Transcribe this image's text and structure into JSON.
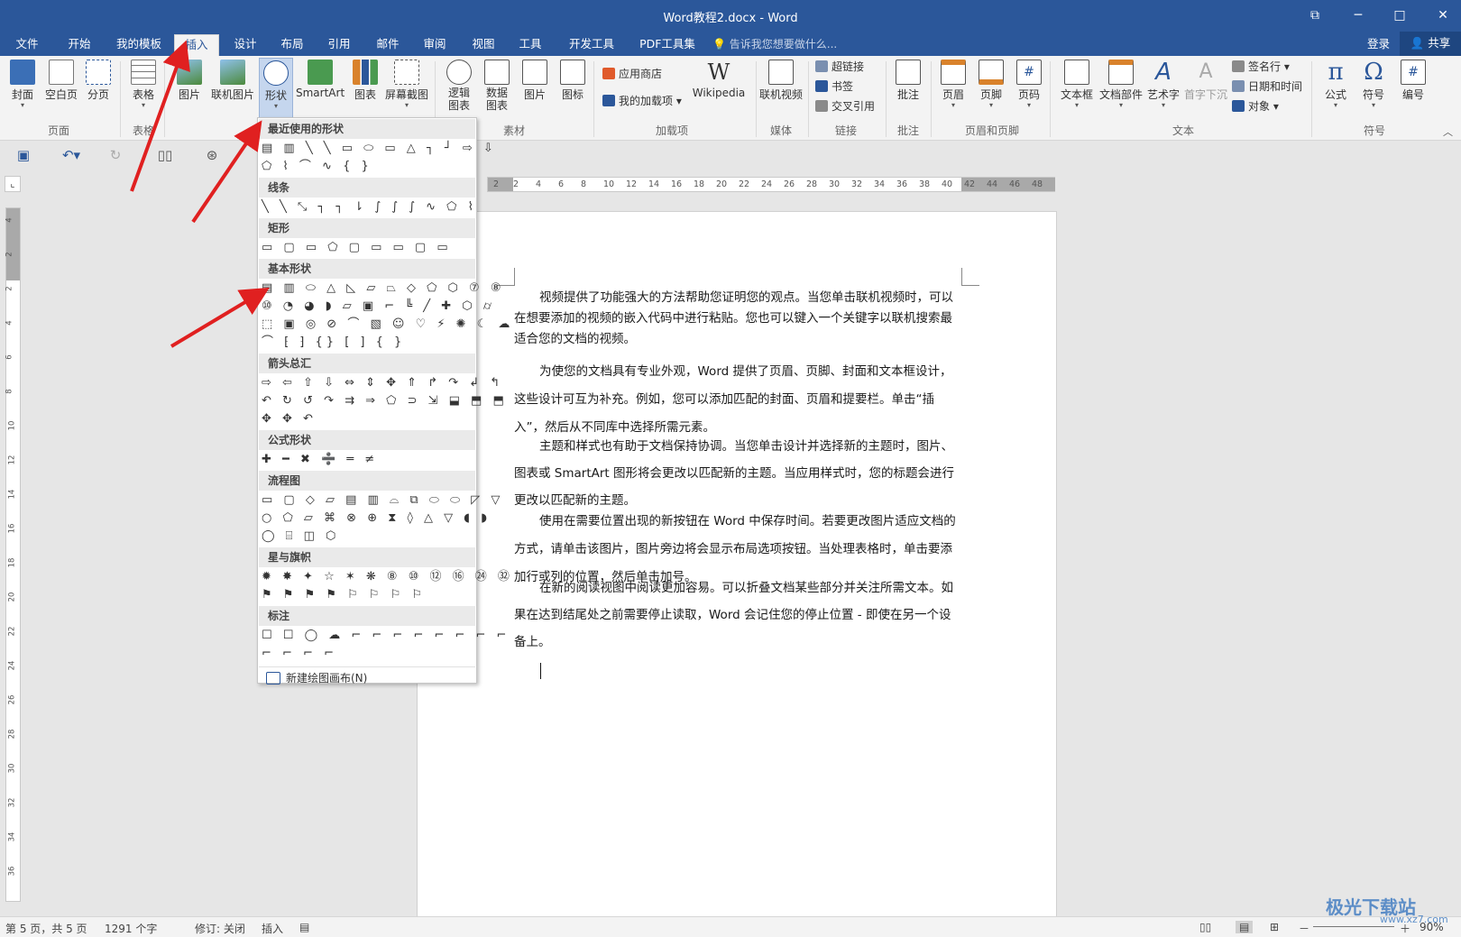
{
  "window": {
    "title": "Word教程2.docx - Word",
    "restore_label": "⧉",
    "minimize_label": "─",
    "maximize_label": "□",
    "close_label": "✕"
  },
  "tabs": [
    "文件",
    "开始",
    "我的模板",
    "插入",
    "设计",
    "布局",
    "引用",
    "邮件",
    "审阅",
    "视图",
    "工具",
    "开发工具",
    "PDF工具集"
  ],
  "active_tab": "插入",
  "tell_me": "告诉我您想要做什么...",
  "login": "登录",
  "share": "共享",
  "ribbon": {
    "pages": {
      "cover": "封面",
      "blank": "空白页",
      "break": "分页",
      "group": "页面"
    },
    "tables": {
      "table": "表格",
      "group": "表格"
    },
    "illus": {
      "picture": "图片",
      "online_picture": "联机图片",
      "shapes": "形状",
      "smartart": "SmartArt",
      "chart": "图表",
      "screenshot": "屏幕截图"
    },
    "material": {
      "logic": "逻辑",
      "logic2": "图表",
      "data": "数据",
      "data2": "图表",
      "picture": "图片",
      "icon": "图标",
      "group": "素材"
    },
    "addins": {
      "store": "应用商店",
      "my_addins": "我的加载项",
      "wikipedia": "Wikipedia",
      "group": "加载项"
    },
    "media": {
      "online_video": "联机视频",
      "group": "媒体"
    },
    "links": {
      "hyperlink": "超链接",
      "bookmark": "书签",
      "crossref": "交叉引用",
      "group": "链接"
    },
    "comments": {
      "comment": "批注",
      "group": "批注"
    },
    "header_footer": {
      "header": "页眉",
      "footer": "页脚",
      "page_number": "页码",
      "group": "页眉和页脚"
    },
    "text": {
      "textbox": "文本框",
      "quickparts": "文档部件",
      "wordart": "艺术字",
      "dropcap": "首字下沉",
      "signature": "签名行",
      "datetime": "日期和时间",
      "object": "对象",
      "group": "文本"
    },
    "symbols": {
      "equation": "公式",
      "symbol": "符号",
      "number": "编号",
      "group": "符号"
    }
  },
  "shapes_gallery": {
    "sections": [
      {
        "title": "最近使用的形状",
        "rows": [
          "▤ ▥ ╲ ╲ ▭ ⬭ ▭ △ ┐ ┘ ⇨ ⇩",
          "⬠ ⌇ ⌒ ∿ { }"
        ]
      },
      {
        "title": "线条",
        "rows": [
          "╲ ╲ ⤡ ┐ ┐ ⇂ ∫ ∫ ∫ ∿ ⬠ ⌇"
        ]
      },
      {
        "title": "矩形",
        "rows": [
          "▭ ▢ ▭ ⬠ ▢ ▭ ▭ ▢ ▭"
        ]
      },
      {
        "title": "基本形状",
        "rows": [
          "▤ ▥ ⬭ △ ◺ ▱ ⏢ ◇ ⬠ ⬡ ⑦ ⑧",
          "⑩ ◔ ◕ ◗ ▱ ▣ ⌐ ╚ ╱ ✚ ⬡ ⌭",
          "⬚ ▣ ◎ ⊘ ⌒ ▧ ☺ ♡ ⚡ ✺ ☾ ☁",
          "⌒ ⁅ ⁆ {} [ ] { }"
        ]
      },
      {
        "title": "箭头总汇",
        "rows": [
          "⇨ ⇦ ⇧ ⇩ ⇔ ⇕ ✥ ⇑ ↱ ↷ ↲ ↰",
          "↶ ↻ ↺ ↷ ⇉ ⇒ ⬠ ⊃ ⇲ ⬓ ⬒ ⬒",
          "✥ ✥ ↶"
        ]
      },
      {
        "title": "公式形状",
        "rows": [
          "✚ ━ ✖ ➗ ═ ≠"
        ]
      },
      {
        "title": "流程图",
        "rows": [
          "▭ ▢ ◇ ▱ ▤ ▥ ⌓ ⧉ ⬭ ⬭ ◸ ▽",
          "○ ⬠ ▱ ⌘ ⊗ ⊕ ⧗ ◊ △ ▽ ◖ ◗",
          "◯ ⌸ ◫ ⬡"
        ]
      },
      {
        "title": "星与旗帜",
        "rows": [
          "✹ ✸ ✦ ☆ ✶ ❋ ⑧ ⑩ ⑫ ⑯ ㉔ ㉜",
          "⚑ ⚑ ⚑ ⚑ ⚐ ⚐ ⚐ ⚐"
        ]
      },
      {
        "title": "标注",
        "rows": [
          "☐ ☐ ◯ ☁ ⌐ ⌐ ⌐ ⌐ ⌐ ⌐ ⌐ ⌐",
          "⌐ ⌐ ⌐ ⌐"
        ]
      }
    ],
    "new_canvas": "新建绘图画布(N)"
  },
  "ruler_h": [
    "2",
    "2",
    "4",
    "6",
    "8",
    "10",
    "12",
    "14",
    "16",
    "18",
    "20",
    "22",
    "24",
    "26",
    "28",
    "30",
    "32",
    "34",
    "36",
    "38",
    "40",
    "42",
    "44",
    "46",
    "48"
  ],
  "ruler_v": [
    "4",
    "2",
    "2",
    "4",
    "6",
    "8",
    "10",
    "12",
    "14",
    "16",
    "18",
    "20",
    "22",
    "24",
    "26",
    "28",
    "30",
    "32",
    "34",
    "36"
  ],
  "document": {
    "paragraphs": [
      "视频提供了功能强大的方法帮助您证明您的观点。当您单击联机视频时，可以在想要添加的视频的嵌入代码中进行粘贴。您也可以键入一个关键字以联机搜索最适合您的文档的视频。",
      "为使您的文档具有专业外观，Word 提供了页眉、页脚、封面和文本框设计，这些设计可互为补充。例如，您可以添加匹配的封面、页眉和提要栏。单击“插入”，然后从不同库中选择所需元素。",
      "主题和样式也有助于文档保持协调。当您单击设计并选择新的主题时，图片、图表或 SmartArt 图形将会更改以匹配新的主题。当应用样式时，您的标题会进行更改以匹配新的主题。",
      "使用在需要位置出现的新按钮在 Word 中保存时间。若要更改图片适应文档的方式，请单击该图片，图片旁边将会显示布局选项按钮。当处理表格时，单击要添加行或列的位置，然后单击加号。",
      "在新的阅读视图中阅读更加容易。可以折叠文档某些部分并关注所需文本。如果在达到结尾处之前需要停止读取，Word 会记住您的停止位置 - 即使在另一个设备上。"
    ]
  },
  "status": {
    "page": "第 5 页，共 5 页",
    "words": "1291 个字",
    "track": "修订: 关闭",
    "insert": "插入",
    "zoom": "90%"
  },
  "watermark": {
    "brand": "极光下载站",
    "url": "www.xz7.com"
  },
  "colors": {
    "accent": "#2b579a",
    "arrow": "#e02020"
  }
}
